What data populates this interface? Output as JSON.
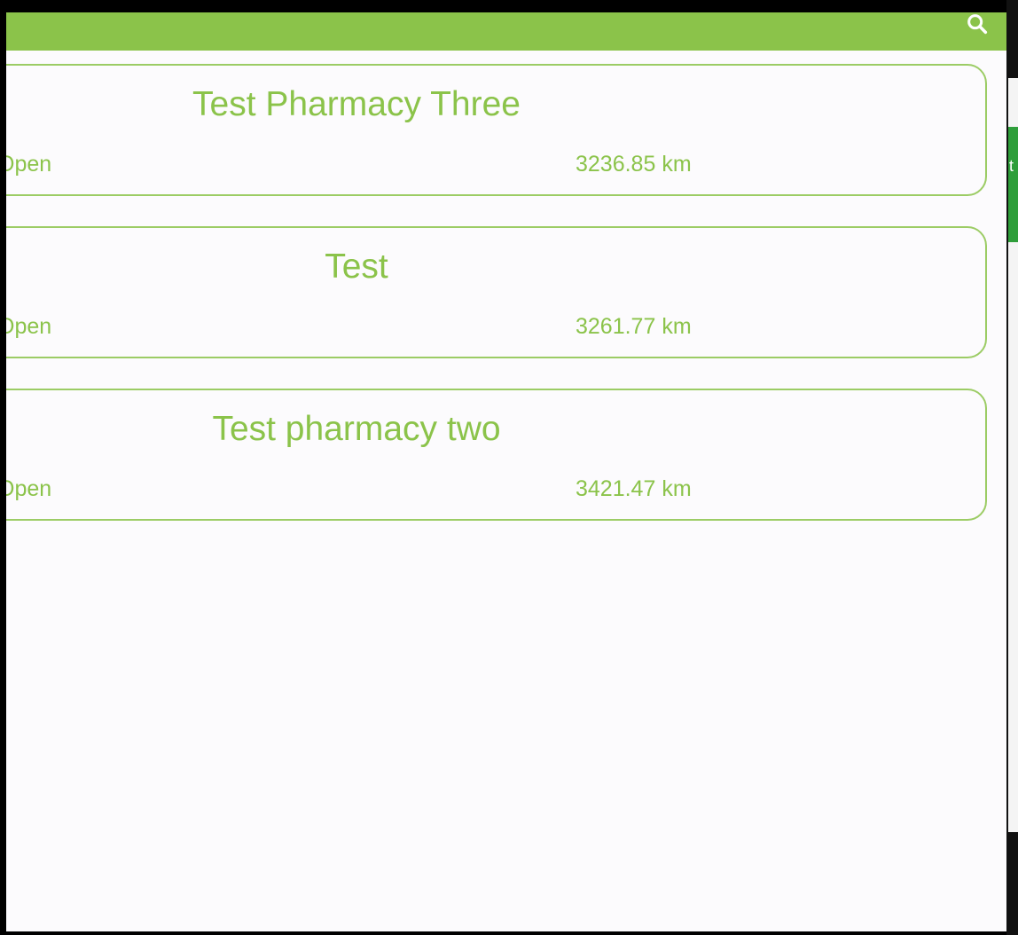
{
  "app": {
    "search_icon": "search-icon",
    "accent_color": "#8bc34a"
  },
  "pharmacies": [
    {
      "name": "Test Pharmacy Three",
      "status": "Open",
      "distance": "3236.85 km"
    },
    {
      "name": "Test",
      "status": "Open",
      "distance": "3261.77 km"
    },
    {
      "name": "Test pharmacy two",
      "status": "Open",
      "distance": "3421.47 km"
    }
  ],
  "background_peek": {
    "fragment": "t"
  }
}
